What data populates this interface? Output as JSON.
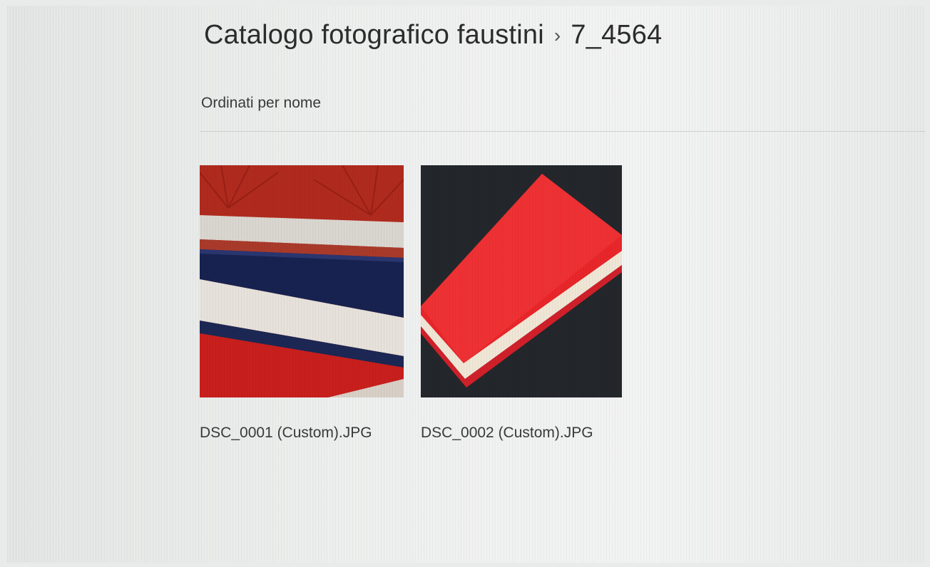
{
  "breadcrumb": {
    "root": "Catalogo fotografico faustini",
    "separator": "›",
    "current": "7_4564"
  },
  "sort": {
    "label": "Ordinati per nome"
  },
  "images": [
    {
      "filename": "DSC_0001 (Custom).JPG",
      "icon": "photo-thumbnail-stacked-albums"
    },
    {
      "filename": "DSC_0002 (Custom).JPG",
      "icon": "photo-thumbnail-red-book"
    }
  ],
  "colors": {
    "album_red": "#c8201e",
    "album_navy": "#16204a",
    "page_cream": "#e9e4dc",
    "photo_background": "#23272b"
  }
}
